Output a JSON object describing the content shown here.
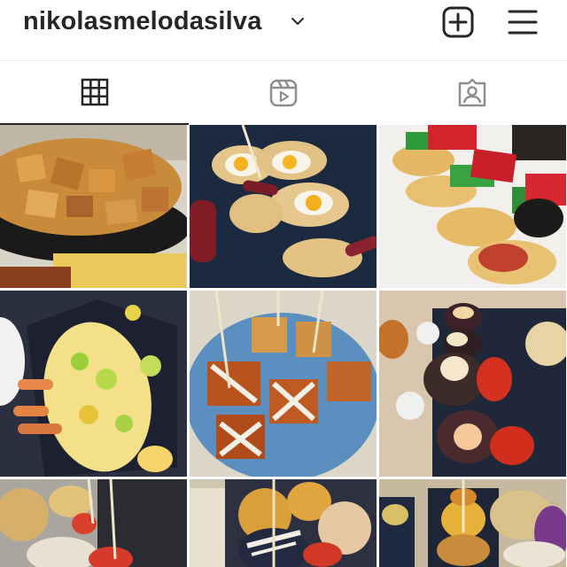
{
  "profile": {
    "username": "nikolasmelodasilva",
    "username_dropdown_icon": "chevron-down-icon",
    "create_icon": "plus-square-icon",
    "menu_icon": "hamburger-menu-icon"
  },
  "tabs": [
    {
      "icon": "grid-icon",
      "active": true
    },
    {
      "icon": "reels-icon",
      "active": false
    },
    {
      "icon": "tagged-icon",
      "active": false
    }
  ],
  "posts": [
    {
      "subject": "fried pork bites"
    },
    {
      "subject": "quail egg and chorizo pintxos"
    },
    {
      "subject": "pepper and tomato pintxos"
    },
    {
      "subject": "shrimp and egg skewers"
    },
    {
      "subject": "pintxos with sauce and chives"
    },
    {
      "subject": "blood sausage pintxos"
    },
    {
      "subject": "skewered pintxos"
    },
    {
      "subject": "croquette pintxos"
    },
    {
      "subject": "assorted pintxos"
    }
  ],
  "colors": {
    "text": "#262626",
    "background": "#ffffff",
    "divider": "#efefef"
  }
}
